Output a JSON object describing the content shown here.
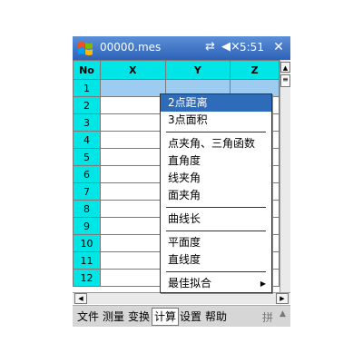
{
  "titlebar": {
    "title": "00000.mes",
    "time": "5:51",
    "connectivity_icon": "⇄",
    "volume_icon": "◀×",
    "close_icon": "✕"
  },
  "grid": {
    "headers": [
      "No",
      "X",
      "Y",
      "Z"
    ],
    "rows": [
      "1",
      "2",
      "3",
      "4",
      "5",
      "6",
      "7",
      "8",
      "9",
      "10",
      "11",
      "12"
    ],
    "selected_row": "1"
  },
  "popup": {
    "items": [
      {
        "label": "2点距离",
        "highlight": true
      },
      {
        "label": "3点面积"
      },
      {
        "sep": true
      },
      {
        "label": "点夹角、三角函数"
      },
      {
        "label": "直角度"
      },
      {
        "label": "线夹角"
      },
      {
        "label": "面夹角"
      },
      {
        "sep": true
      },
      {
        "label": "曲线长"
      },
      {
        "sep": true
      },
      {
        "label": "平面度"
      },
      {
        "label": "直线度"
      },
      {
        "sep": true
      },
      {
        "label": "最佳拟合",
        "submenu": true
      }
    ]
  },
  "menubar": {
    "file": "文件",
    "measure": "测量",
    "transform": "变换",
    "compute": "计算",
    "settings": "设置",
    "help": "帮助",
    "ime": "拼",
    "ime_arrow": "▲"
  },
  "colors": {
    "header_cyan": "#00e5e5",
    "titlebar_blue": "#2e62b8",
    "highlight_blue": "#2e6bb8",
    "selected_row": "#9ecbf0"
  }
}
